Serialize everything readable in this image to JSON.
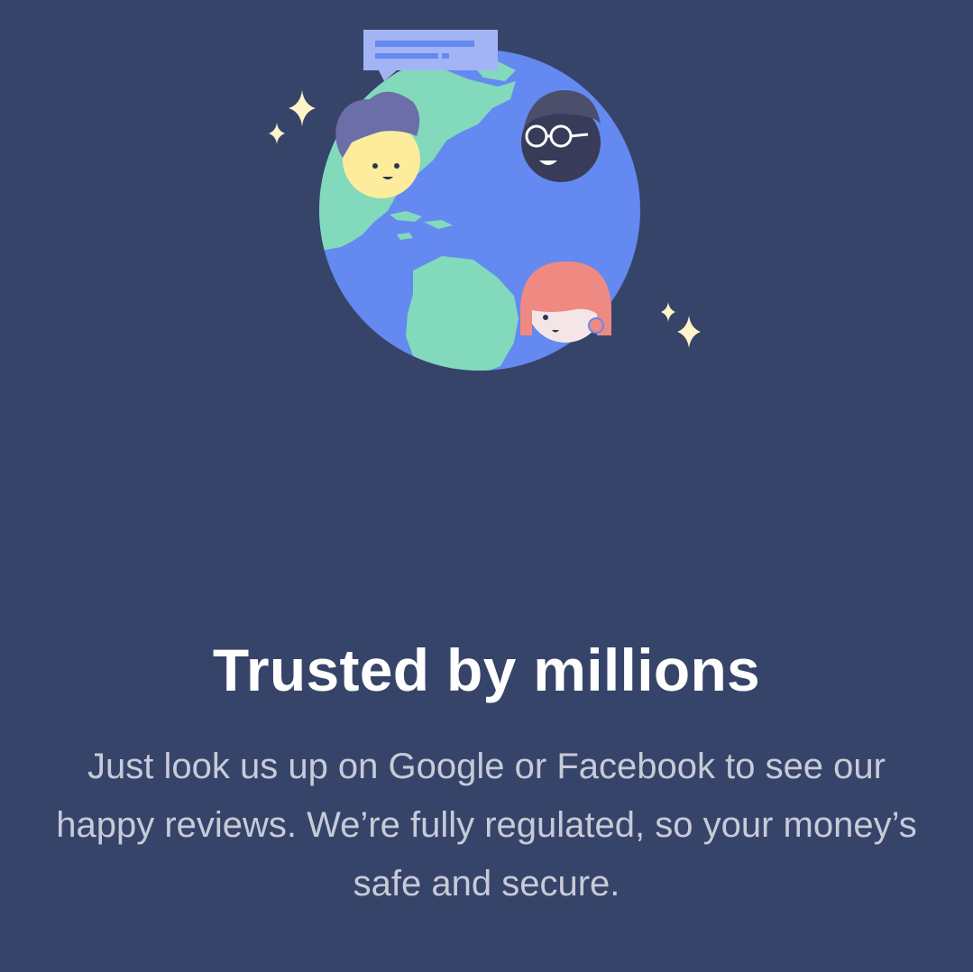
{
  "screen": {
    "background_color": "#374469"
  },
  "illustration": {
    "name": "globe-with-people-illustration",
    "colors": {
      "ocean": "#6489f1",
      "land": "#83d9bb",
      "chat_bubble": "#a3b4f5",
      "sparkle": "#fff5c8",
      "skin_light": "#fcec9c",
      "hair_purple": "#6b6ea8",
      "skin_dark": "#393c58",
      "hair_red": "#ef8a82",
      "skin_pale": "#f4e5e7"
    }
  },
  "content": {
    "headline": "Trusted by millions",
    "body": "Just look us up on Google or Facebook to see our happy reviews. We’re fully regulated, so your money’s safe and secure."
  }
}
